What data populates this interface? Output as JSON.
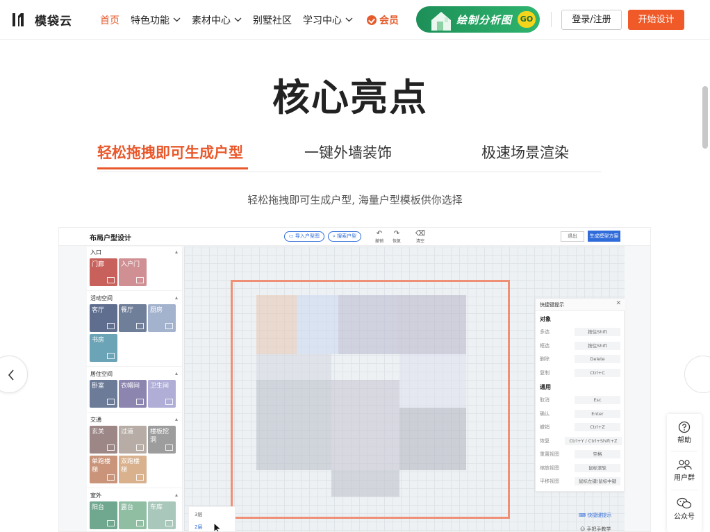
{
  "header": {
    "logo_text": "模袋云",
    "menu": [
      {
        "label": "首页",
        "active": true,
        "dropdown": false
      },
      {
        "label": "特色功能",
        "active": false,
        "dropdown": true
      },
      {
        "label": "素材中心",
        "active": false,
        "dropdown": true
      },
      {
        "label": "别墅社区",
        "active": false,
        "dropdown": false
      },
      {
        "label": "学习中心",
        "active": false,
        "dropdown": true
      }
    ],
    "vip_label": "会员",
    "banner_text": "绘制分析图",
    "banner_go": "GO",
    "login_label": "登录/注册",
    "start_label": "开始设计",
    "accent_color": "#f05a28"
  },
  "section": {
    "title": "核心亮点",
    "tabs": [
      {
        "label": "轻松拖拽即可生成户型",
        "active": true
      },
      {
        "label": "一键外墙装饰",
        "active": false
      },
      {
        "label": "极速场景渲染",
        "active": false
      }
    ],
    "subtitle": "轻松拖拽即可生成户型, 海量户型模板供你选择"
  },
  "app": {
    "title": "布局户型设计",
    "import_label": "导入户型图",
    "search_label": "搜索户型",
    "tools": [
      {
        "icon": "undo-icon",
        "label": "撤销"
      },
      {
        "icon": "redo-icon",
        "label": "恢复"
      },
      {
        "icon": "eraser-icon",
        "label": "清空"
      }
    ],
    "exit_label": "退出",
    "generate_label": "生成模型方案",
    "palette": {
      "sections": [
        {
          "name": "入口",
          "items": [
            {
              "label": "门廊",
              "color": "#c8615c"
            },
            {
              "label": "入户门",
              "color": "#d08f93"
            }
          ]
        },
        {
          "name": "活动空间",
          "items": [
            {
              "label": "客厅",
              "color": "#5f6e8f"
            },
            {
              "label": "餐厅",
              "color": "#6f7e99"
            },
            {
              "label": "厨房",
              "color": "#a4b3cd"
            },
            {
              "label": "书房",
              "color": "#6aa4b6"
            }
          ]
        },
        {
          "name": "居住空间",
          "items": [
            {
              "label": "卧室",
              "color": "#6b7b98"
            },
            {
              "label": "衣帽间",
              "color": "#8c85b0"
            },
            {
              "label": "卫生间",
              "color": "#b0aed6"
            }
          ]
        },
        {
          "name": "交通",
          "items": [
            {
              "label": "玄关",
              "color": "#9c8686"
            },
            {
              "label": "过道",
              "color": "#b7ada6"
            },
            {
              "label": "楼板挖洞",
              "color": "#9d9d9d"
            },
            {
              "label": "单跑楼梯",
              "color": "#c99479"
            },
            {
              "label": "双跑楼梯",
              "color": "#d9b18d"
            }
          ]
        },
        {
          "name": "室外",
          "items": [
            {
              "label": "阳台",
              "color": "#6fa78f"
            },
            {
              "label": "露台",
              "color": "#8fbea3"
            },
            {
              "label": "车库",
              "color": "#a9c7bb"
            }
          ]
        }
      ]
    },
    "shortcuts": {
      "title": "快捷键提示",
      "groups": [
        {
          "name": "对象",
          "rows": [
            {
              "label": "多选",
              "key": "按住Shift"
            },
            {
              "label": "框选",
              "key": "按住Shift"
            },
            {
              "label": "删除",
              "key": "Delete"
            },
            {
              "label": "复制",
              "key": "Ctrl+C"
            }
          ]
        },
        {
          "name": "通用",
          "rows": [
            {
              "label": "取消",
              "key": "Esc"
            },
            {
              "label": "确认",
              "key": "Enter"
            },
            {
              "label": "撤销",
              "key": "Ctrl+Z"
            },
            {
              "label": "恢复",
              "key": "Ctrl+Y / Ctrl+Shift+Z"
            },
            {
              "label": "重置视图",
              "key": "空格"
            },
            {
              "label": "缩放视图",
              "key": "鼠标滚轮"
            },
            {
              "label": "平移视图",
              "key": "鼠标左键/鼠标中键"
            }
          ]
        }
      ]
    },
    "floors": [
      "3层",
      "2层"
    ],
    "shortcut_link": "快捷键提示",
    "tutorial_link": "手把手教学"
  },
  "floatbar": [
    {
      "icon": "help-icon",
      "label": "帮助"
    },
    {
      "icon": "user-group-icon",
      "label": "用户群"
    },
    {
      "icon": "wechat-icon",
      "label": "公众号"
    }
  ]
}
